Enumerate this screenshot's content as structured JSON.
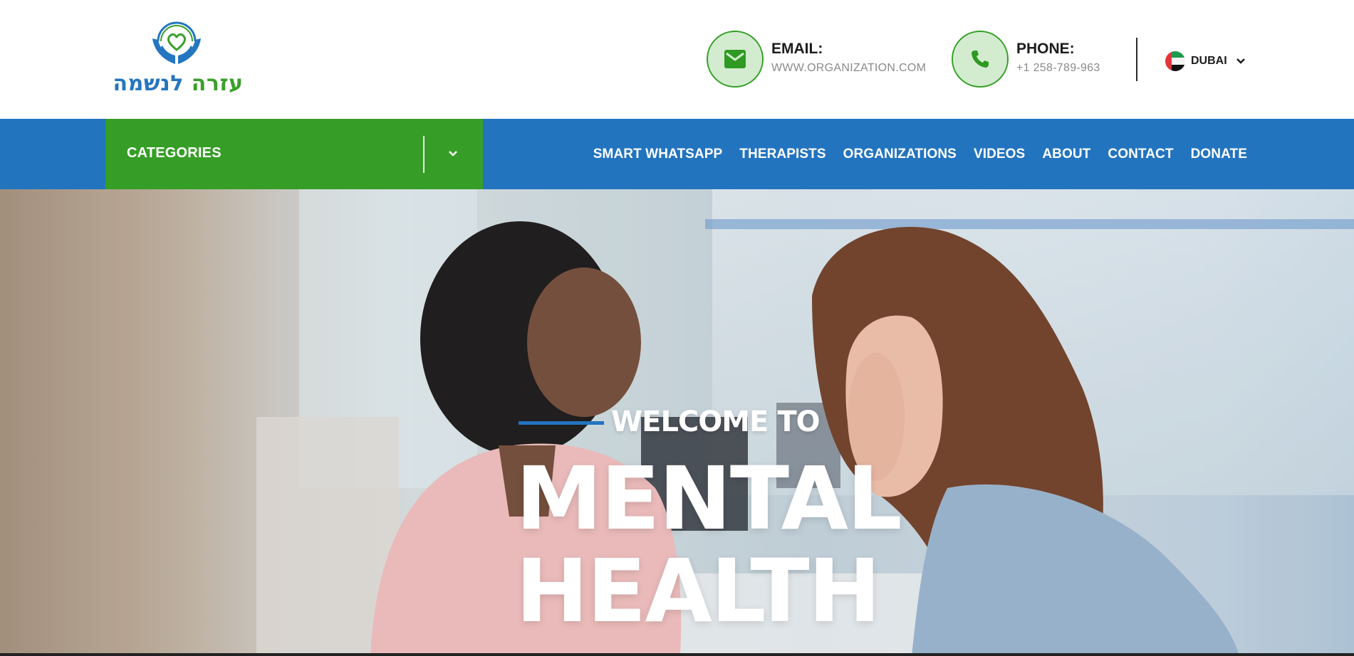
{
  "header": {
    "logo": {
      "word1": "עזרה",
      "word2": "לנשמה"
    },
    "email": {
      "label": "EMAIL:",
      "value": "WWW.ORGANIZATION.COM",
      "icon": "envelope-icon"
    },
    "phone": {
      "label": "PHONE:",
      "value": "+1 258-789-963",
      "icon": "phone-icon"
    },
    "language": {
      "label": "DUBAI",
      "flag": "uae-flag-icon"
    }
  },
  "nav": {
    "categories_label": "CATEGORIES",
    "items": [
      {
        "label": "SMART WHATSAPP"
      },
      {
        "label": "THERAPISTS"
      },
      {
        "label": "ORGANIZATIONS"
      },
      {
        "label": "VIDEOS"
      },
      {
        "label": "ABOUT"
      },
      {
        "label": "CONTACT"
      },
      {
        "label": "DONATE"
      }
    ]
  },
  "hero": {
    "welcome": "WELCOME TO",
    "headline_line1": "MENTAL",
    "headline_line2": "HEALTH"
  },
  "colors": {
    "brand_green": "#369e26",
    "brand_blue": "#2374bf",
    "icon_circle_fill": "#d3ecd0"
  }
}
